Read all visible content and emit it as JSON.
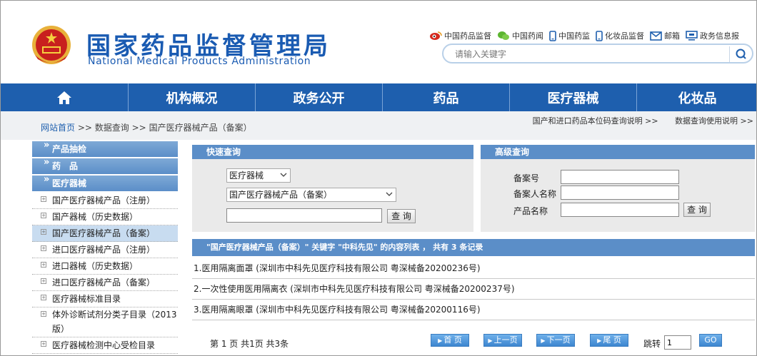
{
  "header": {
    "title_cn": "国家药品监督管理局",
    "title_en": "National Medical Products Administration",
    "top_links": [
      {
        "label": "中国药品监督",
        "icon": "weibo-icon"
      },
      {
        "label": "中国药闻",
        "icon": "wechat-icon"
      },
      {
        "label": "中国药监",
        "icon": "mobile-icon"
      },
      {
        "label": "化妆品监督",
        "icon": "mobile-icon"
      },
      {
        "label": "邮箱",
        "icon": "mail-icon"
      },
      {
        "label": "政务信息报",
        "icon": "monitor-icon"
      }
    ],
    "search_placeholder": "请输入关键字"
  },
  "nav": {
    "items": [
      "",
      "机构概况",
      "政务公开",
      "药品",
      "医疗器械",
      "化妆品"
    ]
  },
  "breadcrumb": {
    "home": "网站首页",
    "sep1": ">>",
    "data_query": "数据查询",
    "sep2": ">>",
    "current": "国产医疗器械产品（备案）"
  },
  "help_links": {
    "code_help": "国产和进口药品本位码查询说明 >>",
    "usage_help": "数据查询使用说明 >>"
  },
  "sidebar": {
    "heads": [
      "产品抽检",
      "药　品",
      "医疗器械"
    ],
    "items": [
      "国产医疗器械产品（注册）",
      "国产器械（历史数据）",
      "国产医疗器械产品（备案）",
      "进口医疗器械产品（注册）",
      "进口器械（历史数据）",
      "进口医疗器械产品（备案）",
      "医疗器械标准目录",
      "体外诊断试剂分类子目录（2013版）",
      "医疗器械检测中心受检目录"
    ],
    "active_index": 2
  },
  "quick_search": {
    "title": "快速查询",
    "category": "医疗器械",
    "database": "国产医疗器械产品（备案）",
    "keyword": "",
    "button": "查 询"
  },
  "advanced_search": {
    "title": "高级查询",
    "fields": [
      "备案号",
      "备案人名称",
      "产品名称"
    ],
    "button": "查 询"
  },
  "results": {
    "header": "\"国产医疗器械产品（备案）\" 关键字 \"中科先见\" 的内容列表 ，  共有 3 条记录",
    "rows": [
      "1.医用隔离面罩 (深圳市中科先见医疗科技有限公司 粤深械备20200236号)",
      "2.一次性使用医用隔离衣 (深圳市中科先见医疗科技有限公司 粤深械备20200237号)",
      "3.医用隔离眼罩 (深圳市中科先见医疗科技有限公司 粤深械备20200116号)"
    ]
  },
  "pager": {
    "summary": "第 1 页 共1页 共3条",
    "first": "首 页",
    "prev": "上一页",
    "next": "下一页",
    "last": "尾 页",
    "jump_label": "跳转",
    "jump_value": "1",
    "go": "GO"
  },
  "colors": {
    "brand_blue": "#1a5bb2",
    "nav_blue": "#1e5fae",
    "panel_blue": "#5b8ec8",
    "active_item": "#c8dcf0"
  }
}
